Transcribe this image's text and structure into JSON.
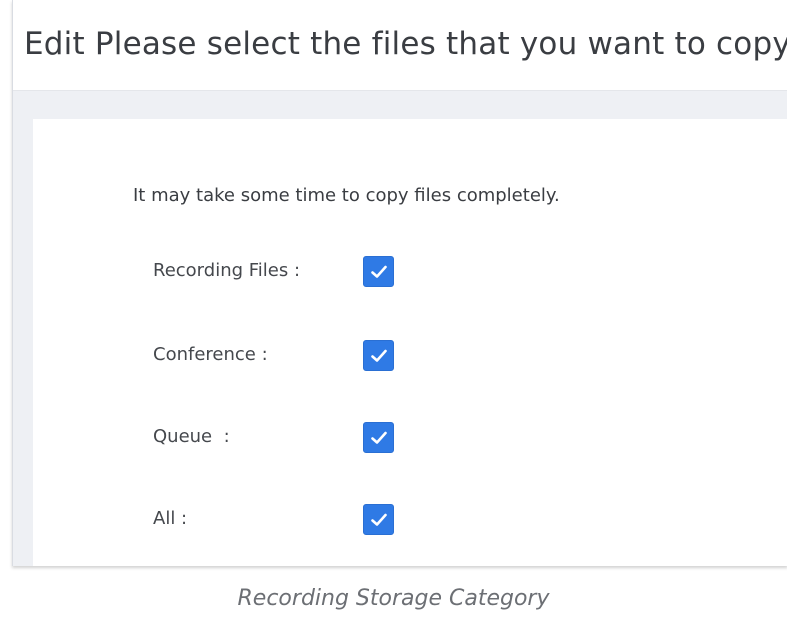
{
  "dialog": {
    "title": "Edit Please select the files that you want to copy.:",
    "notice": "It may take some time to copy files completely.",
    "options": [
      {
        "label": "Recording Files :",
        "checked": true
      },
      {
        "label": "Conference :",
        "checked": true
      },
      {
        "label": "Queue  :",
        "checked": true
      },
      {
        "label": "All :",
        "checked": true
      }
    ]
  },
  "icons": {
    "checkmark": "check-icon"
  },
  "colors": {
    "checkbox_fill": "#2f7ae5",
    "title_text": "#3a3d42",
    "body_background": "#eef0f4"
  },
  "caption": "Recording Storage Category"
}
